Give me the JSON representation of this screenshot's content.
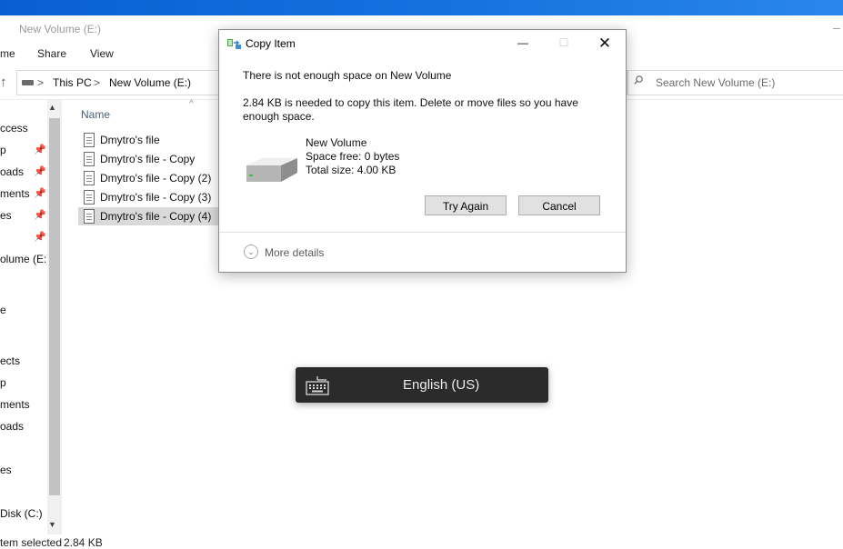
{
  "window": {
    "title": "New Volume (E:)"
  },
  "ribbon": {
    "tabs": [
      "me",
      "Share",
      "View"
    ]
  },
  "address": {
    "crumbs": [
      "This PC",
      "New Volume (E:)"
    ],
    "separators": [
      ">",
      ">"
    ],
    "search_placeholder": "Search New Volume (E:)"
  },
  "nav_pane": {
    "items": [
      "ccess",
      "p",
      "oads",
      "ments",
      "es",
      "",
      "olume (E:)",
      "",
      "e",
      "",
      "ects",
      "p",
      "ments",
      "oads",
      "",
      "es",
      "",
      "Disk (C:)"
    ]
  },
  "file_list": {
    "column_name": "Name",
    "files": [
      {
        "name": "Dmytro's file",
        "selected": false
      },
      {
        "name": "Dmytro's file - Copy",
        "selected": false
      },
      {
        "name": "Dmytro's file - Copy (2)",
        "selected": false
      },
      {
        "name": "Dmytro's file - Copy (3)",
        "selected": false
      },
      {
        "name": "Dmytro's file - Copy (4)",
        "selected": true
      }
    ]
  },
  "status_bar": {
    "selection": "tem selected",
    "size": "2.84 KB"
  },
  "dialog": {
    "title": "Copy Item",
    "heading": "There is not enough space on New Volume",
    "detail": "2.84 KB is needed to copy this item. Delete or move files so you have enough space.",
    "drive_name": "New Volume",
    "space_free": "Space free: 0 bytes",
    "total_size": "Total size: 4.00 KB",
    "try_again_label": "Try Again",
    "cancel_label": "Cancel",
    "more_details_label": "More details"
  },
  "language_toast": {
    "label": "English (US)"
  },
  "colors": {
    "desktop_blue": "#1573e0",
    "toast_bg": "#2b2b2b",
    "selected_row": "#d9d9d9"
  },
  "icons": [
    "keyboard-icon",
    "drive-icon",
    "file-icon",
    "pin-icon",
    "search-icon",
    "copy-icon",
    "close-icon",
    "minimize-icon",
    "maximize-icon",
    "up-arrow-icon",
    "chevron-down-icon"
  ]
}
